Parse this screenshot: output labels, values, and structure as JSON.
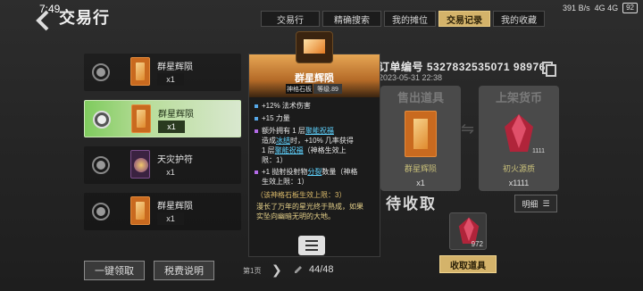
{
  "status_bar": {
    "time": "7:49",
    "net_speed": "391 B/s",
    "signal": "4G 4G",
    "battery": "92"
  },
  "header": {
    "title": "交易行"
  },
  "top_tabs": [
    {
      "label": "交易行"
    },
    {
      "label": "精确搜索"
    },
    {
      "label": "我的摊位"
    },
    {
      "label": "交易记录",
      "active": true
    },
    {
      "label": "我的收藏"
    }
  ],
  "list": [
    {
      "name": "群星辉陨",
      "count": "x1"
    },
    {
      "name": "群星辉陨",
      "count": "x1",
      "selected": true
    },
    {
      "name": "天灾护符",
      "count": "x1"
    },
    {
      "name": "群星辉陨",
      "count": "x1"
    }
  ],
  "bottom": {
    "claim_all": "一键领取",
    "tax_info": "税费说明",
    "page_label": "第1页",
    "page_counter": "44/48"
  },
  "order": {
    "number": "订单编号 5327832535071 98976",
    "date": "2023-05-31 22:38",
    "sold_head": "售出道具",
    "sold_item": "群星辉陨",
    "sold_qty": "x1",
    "currency_head": "上架货币",
    "currency_item": "初火源质",
    "currency_icon_qty": "1111",
    "currency_qty": "x1111",
    "pending_title": "待收取",
    "detail_btn": "明细",
    "pending_qty": "972",
    "claim_btn": "收取道具"
  },
  "tooltip": {
    "name": "群星辉陨",
    "type": "神格石板",
    "level": "等级.89",
    "stats": [
      "+12% 法术伤害",
      "+15 力量"
    ],
    "effect1": [
      "额外拥有 1 层",
      "聚能祝福",
      "",
      "造成",
      "冰结",
      "时，+10% 几率获得",
      "1 层",
      "聚能祝福",
      "（神格生效上",
      "限：1）"
    ],
    "effect2": [
      "+1 抛射投射物",
      "分裂",
      "数量（神格",
      "生效上限：1）"
    ],
    "limit_note": "（该神格石板生效上限：3）",
    "flavor": [
      "漫长了万年的星光终于熟成，如果",
      "实坠向幽暗无明的大地。"
    ]
  },
  "colors": {
    "accent_gold": "#d4b36a",
    "selected_green": "#7fcb5e",
    "cyan_keyword": "#5fd3ff"
  }
}
